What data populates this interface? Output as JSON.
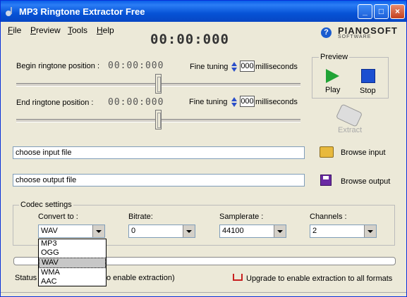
{
  "window": {
    "title": "MP3 Ringtone Extractor Free"
  },
  "menu": [
    {
      "label": "File",
      "accel": "F",
      "rest": "ile"
    },
    {
      "label": "Preview",
      "accel": "P",
      "rest": "review"
    },
    {
      "label": "Tools",
      "accel": "T",
      "rest": "ools"
    },
    {
      "label": "Help",
      "accel": "H",
      "rest": "elp"
    }
  ],
  "timer": "00:00:000",
  "brand": {
    "name": "PIANOSOFT",
    "tagline": "SOFTWARE"
  },
  "begin": {
    "label": "Begin ringtone position :",
    "time": "00:00:000",
    "fine_label": "Fine tuning",
    "ms_value": "000",
    "ms_unit": "milliseconds"
  },
  "end": {
    "label": "End ringtone position :",
    "time": "00:00:000",
    "fine_label": "Fine tuning",
    "ms_value": "000",
    "ms_unit": "milliseconds"
  },
  "preview": {
    "caption": "Preview",
    "play": "Play",
    "stop": "Stop"
  },
  "extract": "Extract",
  "input_file": {
    "value": "choose input file",
    "button": "Browse input"
  },
  "output_file": {
    "value": "choose output file",
    "button": "Browse output"
  },
  "codec": {
    "caption": "Codec settings",
    "convert_label": "Convert to :",
    "convert_value": "WAV",
    "bitrate_label": "Bitrate:",
    "bitrate_value": "0",
    "samplerate_label": "Samplerate :",
    "samplerate_value": "44100",
    "channels_label": "Channels :",
    "channels_value": "2",
    "options": [
      "MP3",
      "OGG",
      "WAV",
      "WMA",
      "AAC"
    ]
  },
  "status": {
    "label": "Status",
    "text": "o enable extraction)"
  },
  "upgrade": "Upgrade to enable extraction to all formats"
}
